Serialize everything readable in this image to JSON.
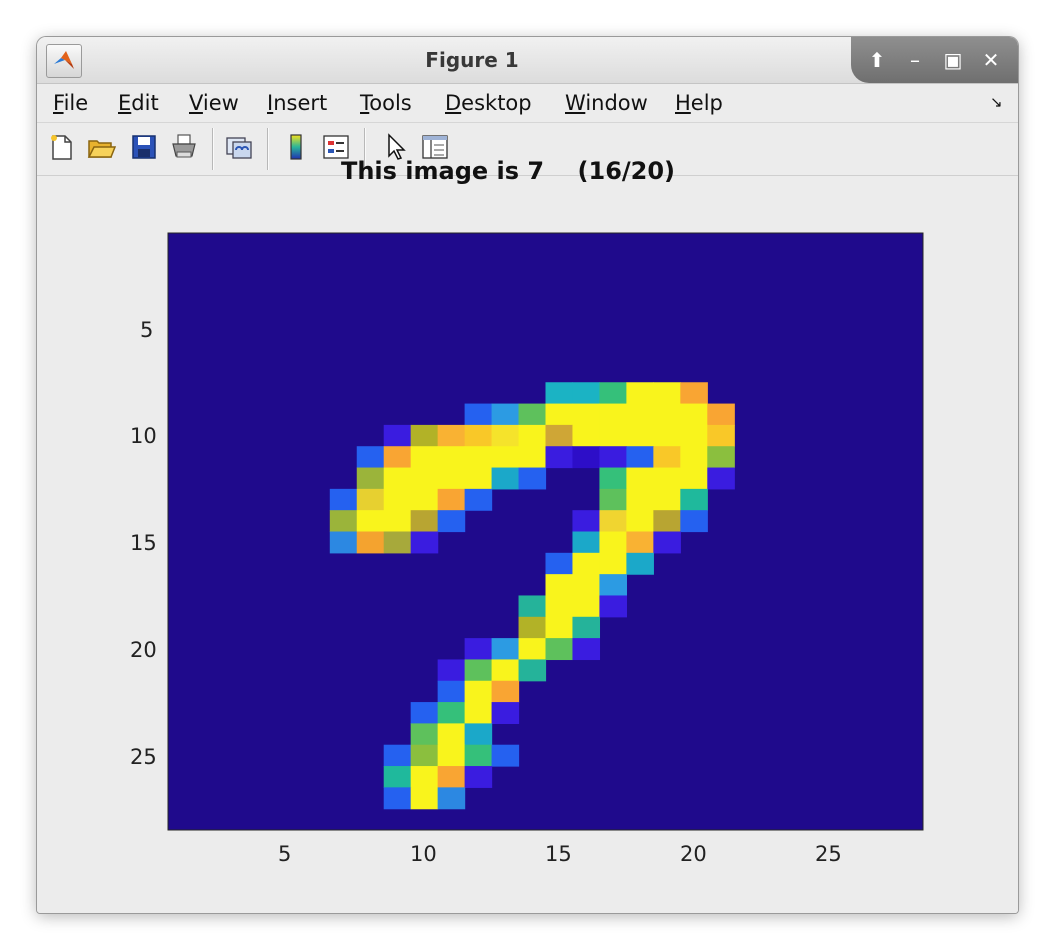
{
  "window": {
    "title": "Figure 1"
  },
  "window_controls": [
    "maximize-up",
    "minimize",
    "restore",
    "close"
  ],
  "menu": [
    {
      "label": "File",
      "mnemonic": "F",
      "rest": "ile"
    },
    {
      "label": "Edit",
      "mnemonic": "E",
      "rest": "dit"
    },
    {
      "label": "View",
      "mnemonic": "V",
      "rest": "iew"
    },
    {
      "label": "Insert",
      "mnemonic": "I",
      "rest": "nsert"
    },
    {
      "label": "Tools",
      "mnemonic": "T",
      "rest": "ools"
    },
    {
      "label": "Desktop",
      "mnemonic": "D",
      "rest": "esktop"
    },
    {
      "label": "Window",
      "mnemonic": "W",
      "rest": "indow"
    },
    {
      "label": "Help",
      "mnemonic": "H",
      "rest": "elp"
    }
  ],
  "toolbar": [
    "new-figure-icon",
    "open-file-icon",
    "save-icon",
    "print-icon",
    "link-plot-icon",
    "colorbar-icon",
    "legend-icon",
    "pointer-icon",
    "property-inspector-icon"
  ],
  "plot": {
    "title": "This image is 7    (16/20)",
    "x_ticks": [
      "5",
      "10",
      "15",
      "20",
      "25"
    ],
    "y_ticks": [
      "5",
      "10",
      "15",
      "20",
      "25"
    ],
    "xlim": [
      0.5,
      28.5
    ],
    "ylim": [
      0.5,
      28.5
    ],
    "colormap": "parula",
    "background_color": "#1f0a8c",
    "pixels": [
      [
        8,
        15,
        "#1bb3c4"
      ],
      [
        8,
        16,
        "#1bb3c4"
      ],
      [
        8,
        17,
        "#35c07a"
      ],
      [
        8,
        18,
        "#f9f41c"
      ],
      [
        8,
        19,
        "#f9f41c"
      ],
      [
        8,
        20,
        "#f9a533"
      ],
      [
        9,
        12,
        "#2561f0"
      ],
      [
        9,
        13,
        "#2c9be3"
      ],
      [
        9,
        14,
        "#5ec15c"
      ],
      [
        9,
        15,
        "#f9f41c"
      ],
      [
        9,
        16,
        "#f9f41c"
      ],
      [
        9,
        17,
        "#f9f41c"
      ],
      [
        9,
        18,
        "#f9f41c"
      ],
      [
        9,
        19,
        "#f9f41c"
      ],
      [
        9,
        20,
        "#f9f41c"
      ],
      [
        9,
        21,
        "#f9a533"
      ],
      [
        10,
        9,
        "#3a1ce0"
      ],
      [
        10,
        10,
        "#b2b227"
      ],
      [
        10,
        11,
        "#f9b233"
      ],
      [
        10,
        12,
        "#f9c828"
      ],
      [
        10,
        13,
        "#f5e32b"
      ],
      [
        10,
        14,
        "#f9f41c"
      ],
      [
        10,
        15,
        "#cfa636"
      ],
      [
        10,
        16,
        "#f9f41c"
      ],
      [
        10,
        17,
        "#f9f41c"
      ],
      [
        10,
        18,
        "#f9f41c"
      ],
      [
        10,
        19,
        "#f9f41c"
      ],
      [
        10,
        20,
        "#f9f41c"
      ],
      [
        10,
        21,
        "#f9c828"
      ],
      [
        11,
        8,
        "#2561f0"
      ],
      [
        11,
        9,
        "#f9a533"
      ],
      [
        11,
        10,
        "#f9f41c"
      ],
      [
        11,
        11,
        "#f9f41c"
      ],
      [
        11,
        12,
        "#f9f41c"
      ],
      [
        11,
        13,
        "#f9f41c"
      ],
      [
        11,
        14,
        "#f9f41c"
      ],
      [
        11,
        15,
        "#3a1ce0"
      ],
      [
        11,
        16,
        "#2d0ec8"
      ],
      [
        11,
        17,
        "#3a1ce0"
      ],
      [
        11,
        18,
        "#2561f0"
      ],
      [
        11,
        19,
        "#f9c828"
      ],
      [
        11,
        20,
        "#f9f41c"
      ],
      [
        11,
        21,
        "#8bbf3e"
      ],
      [
        12,
        8,
        "#9bb43a"
      ],
      [
        12,
        9,
        "#f9f41c"
      ],
      [
        12,
        10,
        "#f9f41c"
      ],
      [
        12,
        11,
        "#f9f41c"
      ],
      [
        12,
        12,
        "#f9f41c"
      ],
      [
        12,
        13,
        "#1ba8c9"
      ],
      [
        12,
        14,
        "#2561f0"
      ],
      [
        12,
        17,
        "#35c07a"
      ],
      [
        12,
        18,
        "#f9f41c"
      ],
      [
        12,
        19,
        "#f9f41c"
      ],
      [
        12,
        20,
        "#f9f41c"
      ],
      [
        12,
        21,
        "#3a1ce0"
      ],
      [
        13,
        7,
        "#2561f0"
      ],
      [
        13,
        8,
        "#e7d030"
      ],
      [
        13,
        9,
        "#f9f41c"
      ],
      [
        13,
        10,
        "#f9f41c"
      ],
      [
        13,
        11,
        "#f9a533"
      ],
      [
        13,
        12,
        "#2561f0"
      ],
      [
        13,
        17,
        "#5ec15c"
      ],
      [
        13,
        18,
        "#f9f41c"
      ],
      [
        13,
        19,
        "#f9f41c"
      ],
      [
        13,
        20,
        "#1fb99c"
      ],
      [
        14,
        7,
        "#9bb43a"
      ],
      [
        14,
        8,
        "#f9f41c"
      ],
      [
        14,
        9,
        "#f9f41c"
      ],
      [
        14,
        10,
        "#b8a532"
      ],
      [
        14,
        11,
        "#2561f0"
      ],
      [
        14,
        16,
        "#3a1ce0"
      ],
      [
        14,
        17,
        "#f0d530"
      ],
      [
        14,
        18,
        "#f9f41c"
      ],
      [
        14,
        19,
        "#b8a532"
      ],
      [
        14,
        20,
        "#2561f0"
      ],
      [
        15,
        7,
        "#2c88e2"
      ],
      [
        15,
        8,
        "#f4a32f"
      ],
      [
        15,
        9,
        "#a7a93b"
      ],
      [
        15,
        10,
        "#3a1ce0"
      ],
      [
        15,
        16,
        "#1ba8c9"
      ],
      [
        15,
        17,
        "#f9f41c"
      ],
      [
        15,
        18,
        "#f9b233"
      ],
      [
        15,
        19,
        "#3a1ce0"
      ],
      [
        16,
        15,
        "#2561f0"
      ],
      [
        16,
        16,
        "#f9f41c"
      ],
      [
        16,
        17,
        "#f9f41c"
      ],
      [
        16,
        18,
        "#1ba8c9"
      ],
      [
        17,
        15,
        "#f9f41c"
      ],
      [
        17,
        16,
        "#f9f41c"
      ],
      [
        17,
        17,
        "#2c9be3"
      ],
      [
        18,
        14,
        "#25b39a"
      ],
      [
        18,
        15,
        "#f9f41c"
      ],
      [
        18,
        16,
        "#f9f41c"
      ],
      [
        18,
        17,
        "#3a1ce0"
      ],
      [
        19,
        14,
        "#b2b227"
      ],
      [
        19,
        15,
        "#f9f41c"
      ],
      [
        19,
        16,
        "#25b39a"
      ],
      [
        20,
        12,
        "#3a1ce0"
      ],
      [
        20,
        13,
        "#2c9be3"
      ],
      [
        20,
        14,
        "#f9f41c"
      ],
      [
        20,
        15,
        "#5ec15c"
      ],
      [
        20,
        16,
        "#3a1ce0"
      ],
      [
        21,
        11,
        "#3a1ce0"
      ],
      [
        21,
        12,
        "#5ec15c"
      ],
      [
        21,
        13,
        "#f9f41c"
      ],
      [
        21,
        14,
        "#25b39a"
      ],
      [
        22,
        11,
        "#2561f0"
      ],
      [
        22,
        12,
        "#f9f41c"
      ],
      [
        22,
        13,
        "#f9a533"
      ],
      [
        23,
        10,
        "#2561f0"
      ],
      [
        23,
        11,
        "#35c07a"
      ],
      [
        23,
        12,
        "#f9f41c"
      ],
      [
        23,
        13,
        "#3a1ce0"
      ],
      [
        24,
        10,
        "#5ec15c"
      ],
      [
        24,
        11,
        "#f9f41c"
      ],
      [
        24,
        12,
        "#1ba8c9"
      ],
      [
        25,
        9,
        "#2561f0"
      ],
      [
        25,
        10,
        "#8bbf3e"
      ],
      [
        25,
        11,
        "#f9f41c"
      ],
      [
        25,
        12,
        "#35c07a"
      ],
      [
        25,
        13,
        "#2561f0"
      ],
      [
        26,
        9,
        "#1fb99c"
      ],
      [
        26,
        10,
        "#f9f41c"
      ],
      [
        26,
        11,
        "#f9a533"
      ],
      [
        26,
        12,
        "#3a1ce0"
      ],
      [
        27,
        9,
        "#2561f0"
      ],
      [
        27,
        10,
        "#f9f41c"
      ],
      [
        27,
        11,
        "#2c88e2"
      ]
    ]
  }
}
